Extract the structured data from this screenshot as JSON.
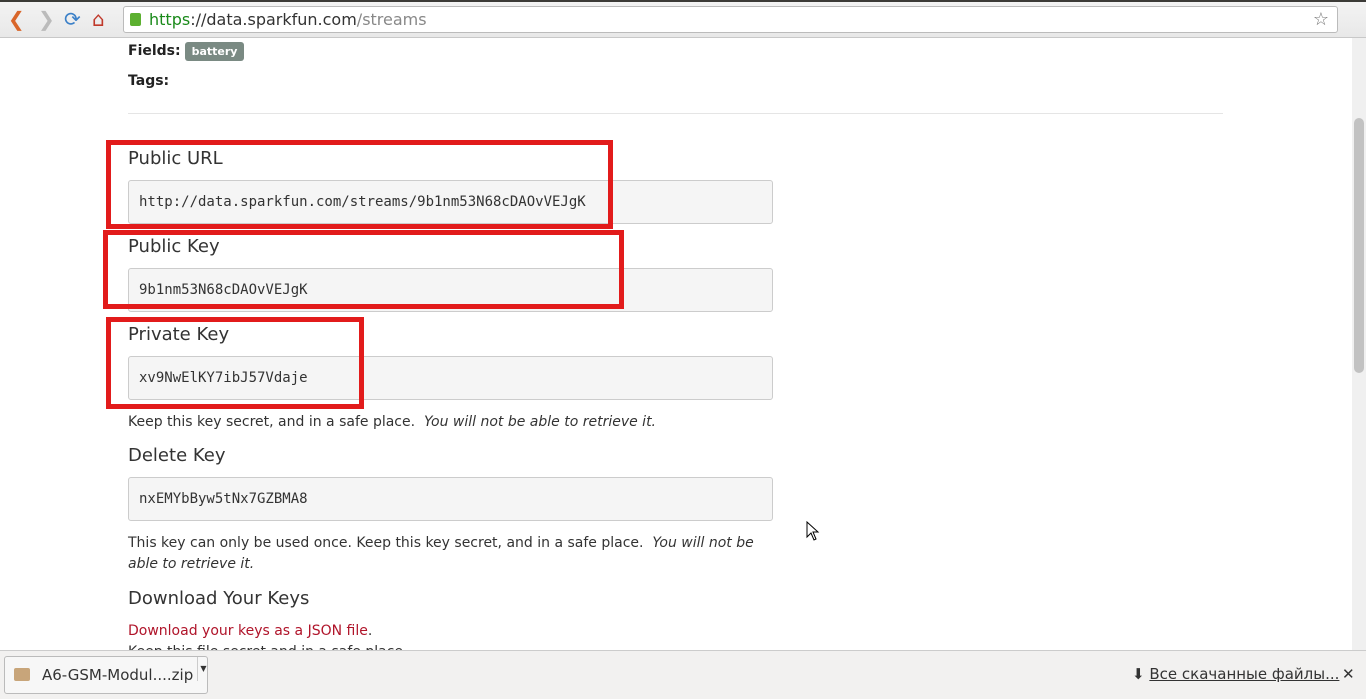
{
  "browser": {
    "url_scheme": "https",
    "url_host": "://data.sparkfun.com",
    "url_path": "/streams"
  },
  "stream": {
    "fields_label": "Fields:",
    "fields": [
      "battery"
    ],
    "tags_label": "Tags:"
  },
  "keys": {
    "public_url_label": "Public URL",
    "public_url": "http://data.sparkfun.com/streams/9b1nm53N68cDAOvVEJgK",
    "public_key_label": "Public Key",
    "public_key": "9b1nm53N68cDAOvVEJgK",
    "private_key_label": "Private Key",
    "private_key": "xv9NwElKY7ibJ57Vdaje",
    "private_note": "Keep this key secret, and in a safe place.",
    "private_note_em": "You will not be able to retrieve it.",
    "delete_key_label": "Delete Key",
    "delete_key": "nxEMYbByw5tNx7GZBMA8",
    "delete_note": "This key can only be used once.  Keep this key secret, and in a safe place.",
    "delete_note_em": "You will not be able to retrieve it.",
    "download_heading": "Download Your Keys",
    "download_link": "Download your keys as a JSON file",
    "download_after": ".",
    "file_note": "Keep this file secret and in a safe place."
  },
  "downloads": {
    "file": "A6-GSM-Modul....zip",
    "show_all": "Все скачанные файлы..."
  },
  "colors": {
    "highlight": "#e21b1b",
    "link": "#b0142a"
  }
}
